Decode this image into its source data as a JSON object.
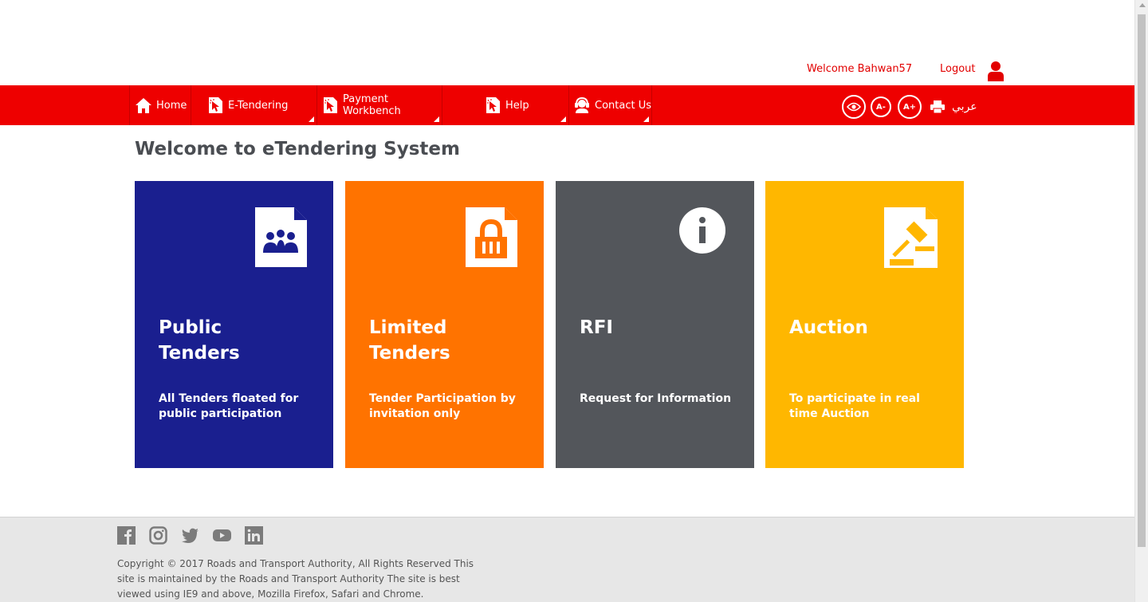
{
  "header": {
    "welcome_text": "Welcome Bahwan57",
    "logout_label": "Logout"
  },
  "nav": {
    "items": [
      {
        "label": "Home",
        "icon": "home-icon"
      },
      {
        "label": "E-Tendering",
        "icon": "document-cursor-icon"
      },
      {
        "label": "Payment Workbench",
        "icon": "document-cursor-icon"
      },
      {
        "label": "Help",
        "icon": "document-cursor-icon"
      },
      {
        "label": "Contact Us",
        "icon": "headset-icon"
      }
    ],
    "tools": {
      "font_decrease": "A-",
      "font_increase": "A+",
      "language": "عربي"
    }
  },
  "main": {
    "title": "Welcome to eTendering System",
    "cards": [
      {
        "title": "Public Tenders",
        "desc": "All Tenders floated for public participation",
        "color": "#1a1f8f",
        "icon": "people-document-icon"
      },
      {
        "title": "Limited Tenders",
        "desc": "Tender Participation by invitation only",
        "color": "#ff7300",
        "icon": "lock-document-icon"
      },
      {
        "title": "RFI",
        "desc": "Request for Information",
        "color": "#53565b",
        "icon": "info-icon"
      },
      {
        "title": "Auction",
        "desc": "To participate in real time Auction",
        "color": "#ffb700",
        "icon": "gavel-document-icon"
      }
    ]
  },
  "footer": {
    "social": [
      "facebook-icon",
      "instagram-icon",
      "twitter-icon",
      "youtube-icon",
      "linkedin-icon"
    ],
    "copyright": "Copyright © 2017 Roads and Transport Authority, All Rights Reserved This site is maintained by the Roads and Transport Authority The site is best viewed using IE9 and above, Mozilla Firefox, Safari and Chrome."
  },
  "colors": {
    "brand_red": "#ee0000",
    "title_gray": "#4a4d52",
    "footer_bg": "#e7e7e7"
  }
}
